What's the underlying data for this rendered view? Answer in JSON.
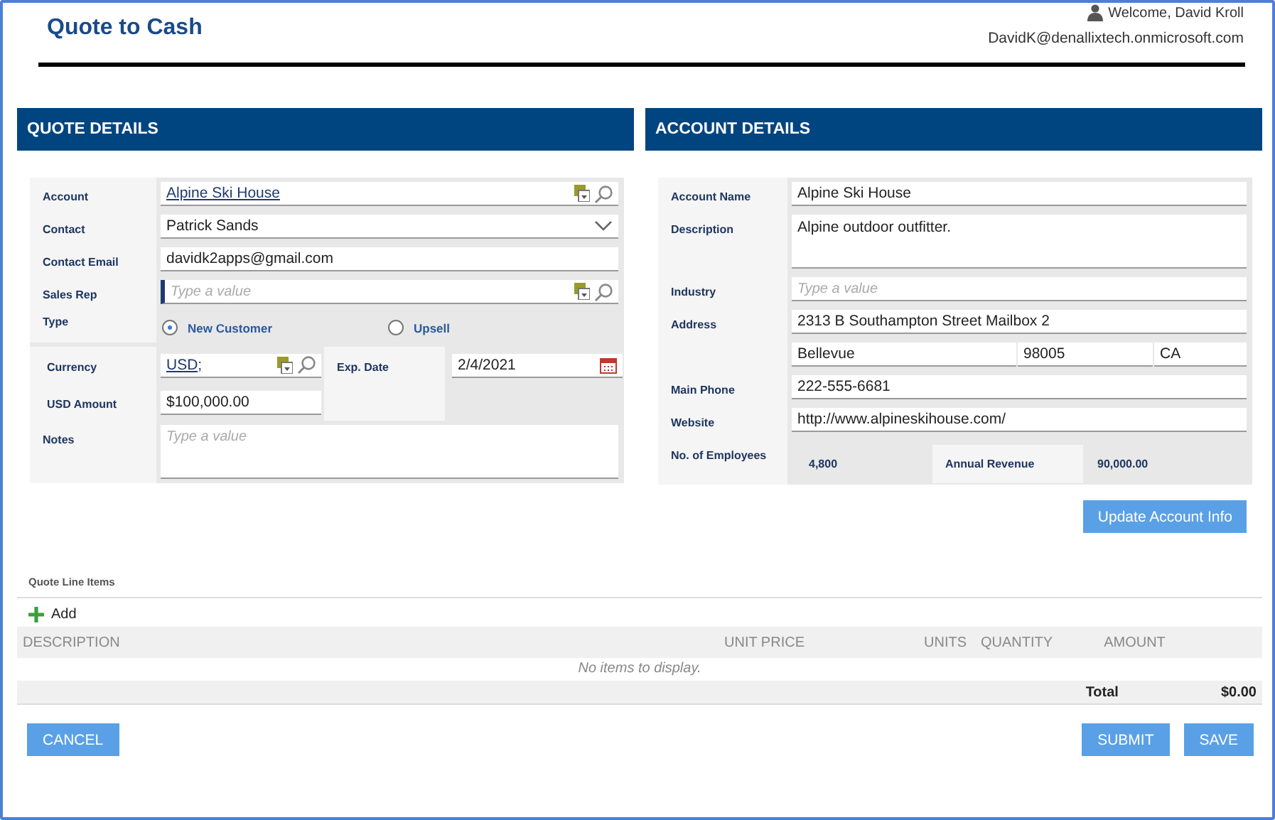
{
  "header": {
    "title": "Quote to Cash",
    "welcome": "Welcome, David Kroll",
    "email": "DavidK@denallixtech.onmicrosoft.com"
  },
  "quote_details": {
    "heading": "QUOTE DETAILS",
    "account": {
      "label": "Account",
      "value": "Alpine Ski House"
    },
    "contact": {
      "label": "Contact",
      "value": "Patrick Sands"
    },
    "contact_email": {
      "label": "Contact Email",
      "value": "davidk2apps@gmail.com"
    },
    "sales_rep": {
      "label": "Sales Rep",
      "placeholder": "Type a value"
    },
    "type": {
      "label": "Type",
      "options": [
        {
          "label": "New Customer",
          "selected": true
        },
        {
          "label": "Upsell",
          "selected": false
        }
      ]
    },
    "currency": {
      "label": "Currency",
      "value": "USD;"
    },
    "exp_date": {
      "label": "Exp. Date",
      "value": "2/4/2021"
    },
    "usd_amount": {
      "label": "USD Amount",
      "value": "$100,000.00"
    },
    "notes": {
      "label": "Notes",
      "placeholder": "Type a value"
    }
  },
  "account_details": {
    "heading": "ACCOUNT DETAILS",
    "account_name": {
      "label": "Account Name",
      "value": "Alpine Ski House"
    },
    "description": {
      "label": "Description",
      "value": "Alpine outdoor outfitter."
    },
    "industry": {
      "label": "Industry",
      "placeholder": "Type a value"
    },
    "address": {
      "label": "Address",
      "street": "2313 B Southampton Street Mailbox 2",
      "city": "Bellevue",
      "zip": "98005",
      "state": "CA"
    },
    "main_phone": {
      "label": "Main Phone",
      "value": "222-555-6681"
    },
    "website": {
      "label": "Website",
      "value": "http://www.alpineskihouse.com/"
    },
    "employees": {
      "label": "No. of Employees",
      "value": "4,800"
    },
    "annual_revenue": {
      "label": "Annual Revenue",
      "value": "90,000.00"
    },
    "update_button": "Update Account Info"
  },
  "line_items": {
    "title": "Quote Line Items",
    "add_button": "Add",
    "columns": [
      "DESCRIPTION",
      "UNIT PRICE",
      "UNITS",
      "QUANTITY",
      "AMOUNT"
    ],
    "empty_message": "No items to display.",
    "total_label": "Total",
    "total_value": "$0.00"
  },
  "buttons": {
    "cancel": "CANCEL",
    "submit": "SUBMIT",
    "save": "SAVE"
  }
}
